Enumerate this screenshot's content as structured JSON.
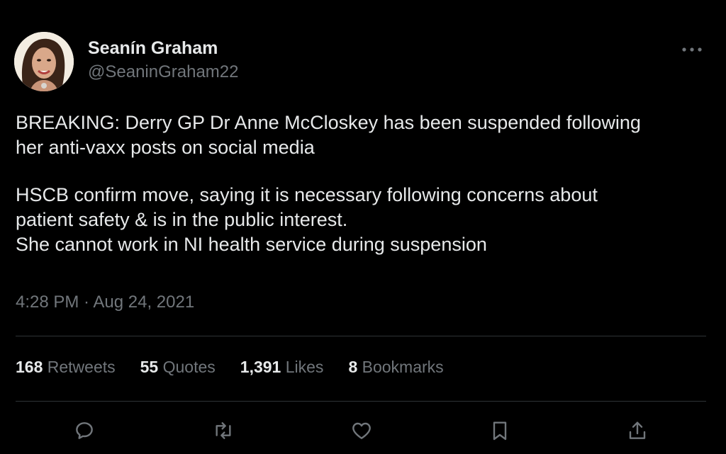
{
  "author": {
    "display_name": "Seanín Graham",
    "handle": "@SeaninGraham22"
  },
  "tweet": {
    "paragraphs": [
      [
        "BREAKING: Derry GP Dr Anne McCloskey has been suspended following",
        "her anti-vaxx posts on social media"
      ],
      [
        "HSCB confirm move, saying it is necessary following concerns about",
        "patient safety & is in the public interest.",
        "She cannot work in NI health service during suspension"
      ]
    ],
    "timestamp": "4:28 PM · Aug 24, 2021"
  },
  "stats": {
    "retweets": {
      "count": "168",
      "label": "Retweets"
    },
    "quotes": {
      "count": "55",
      "label": "Quotes"
    },
    "likes": {
      "count": "1,391",
      "label": "Likes"
    },
    "bookmarks": {
      "count": "8",
      "label": "Bookmarks"
    }
  },
  "icons": {
    "more": "more-horizontal-icon",
    "reply": "reply-icon",
    "retweet": "retweet-icon",
    "like": "heart-icon",
    "bookmark": "bookmark-icon",
    "share": "share-icon"
  },
  "colors": {
    "background": "#000000",
    "primary_text": "#e7e9ea",
    "secondary_text": "#71767b",
    "divider": "#2f3336"
  }
}
